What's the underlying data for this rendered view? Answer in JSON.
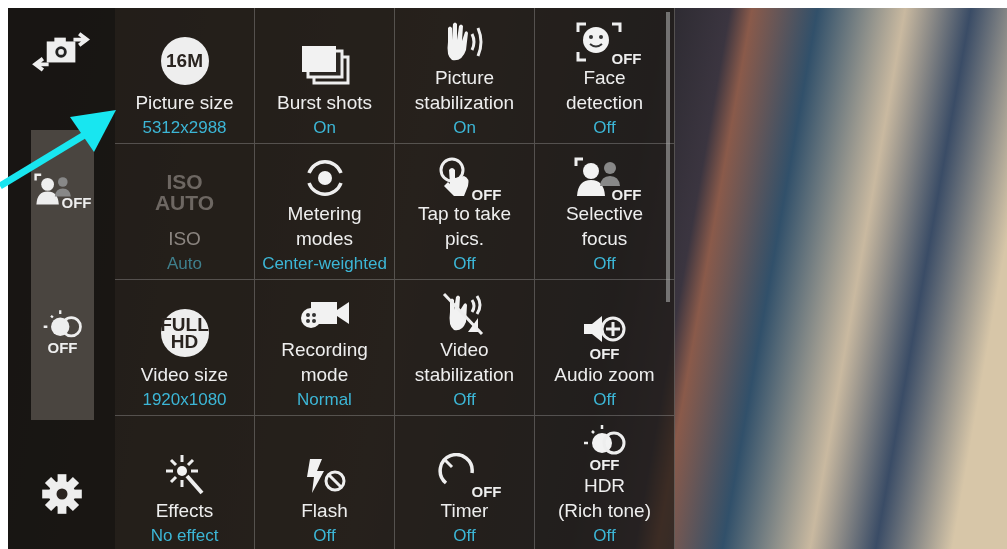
{
  "sidebar": {
    "shortcuts": [
      {
        "badge": "OFF"
      },
      {
        "badge": "OFF"
      }
    ]
  },
  "settings": [
    {
      "label": "Picture size",
      "value": "5312x2988",
      "disabled": false,
      "icon_text": {
        "kind": "circle",
        "text": "16M"
      }
    },
    {
      "label": "Burst shots",
      "value": "On",
      "disabled": false
    },
    {
      "label": "Picture\nstabilization",
      "value": "On",
      "disabled": false
    },
    {
      "label": "Face\ndetection",
      "value": "Off",
      "disabled": false,
      "icon_text": {
        "kind": "off",
        "text": "OFF"
      }
    },
    {
      "label": "ISO",
      "value": "Auto",
      "disabled": true,
      "icon_text": {
        "kind": "plain",
        "text": "ISO\nAUTO"
      }
    },
    {
      "label": "Metering\nmodes",
      "value": "Center-weighted",
      "disabled": false
    },
    {
      "label": "Tap to take\npics.",
      "value": "Off",
      "disabled": false,
      "icon_text": {
        "kind": "off",
        "text": "OFF"
      }
    },
    {
      "label": "Selective\nfocus",
      "value": "Off",
      "disabled": false,
      "icon_text": {
        "kind": "off",
        "text": "OFF"
      }
    },
    {
      "label": "Video size",
      "value": "1920x1080",
      "disabled": false,
      "icon_text": {
        "kind": "circle",
        "text": "FULL\nHD"
      }
    },
    {
      "label": "Recording\nmode",
      "value": "Normal",
      "disabled": false
    },
    {
      "label": "Video\nstabilization",
      "value": "Off",
      "disabled": false
    },
    {
      "label": "Audio zoom",
      "value": "Off",
      "disabled": false,
      "icon_text": {
        "kind": "below",
        "text": "OFF"
      }
    },
    {
      "label": "Effects",
      "value": "No effect",
      "disabled": false
    },
    {
      "label": "Flash",
      "value": "Off",
      "disabled": false
    },
    {
      "label": "Timer",
      "value": "Off",
      "disabled": false,
      "icon_text": {
        "kind": "off",
        "text": "OFF"
      }
    },
    {
      "label": "HDR\n(Rich tone)",
      "value": "Off",
      "disabled": false,
      "icon_text": {
        "kind": "below",
        "text": "OFF"
      }
    }
  ]
}
